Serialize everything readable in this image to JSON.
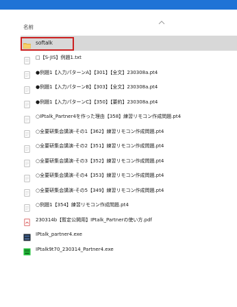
{
  "header": {
    "name_column": "名前"
  },
  "files": [
    {
      "label": "softalk",
      "icon": "folder-icon",
      "selected": true
    },
    {
      "label": "□【S-JIS】例題1.txt",
      "icon": "text-file-icon"
    },
    {
      "label": "●例題1【入力パターンA】【301】【全文】230308a.pt4",
      "icon": "document-icon"
    },
    {
      "label": "●例題1【入力パターンB】【303】【全文】230308a.pt4",
      "icon": "document-icon"
    },
    {
      "label": "●例題1【入力パターンC】【350】【要約】230308a.pt4",
      "icon": "document-icon"
    },
    {
      "label": "○IPtalk_Partner4を作った理由【358】練習リモコン作成問題.pt4",
      "icon": "document-icon"
    },
    {
      "label": "○全要研集会講演-その1【362】練習リモコン作成問題.pt4",
      "icon": "document-icon"
    },
    {
      "label": "○全要研集会講演-その2【351】練習リモコン作成問題.pt4",
      "icon": "document-icon"
    },
    {
      "label": "○全要研集会講演-その3【352】練習リモコン作成問題.pt4",
      "icon": "document-icon"
    },
    {
      "label": "○全要研集会講演-その4【353】練習リモコン作成問題.pt4",
      "icon": "document-icon"
    },
    {
      "label": "○全要研集会講演-その5【349】練習リモコン作成問題.pt4",
      "icon": "document-icon"
    },
    {
      "label": "○例題1【354】練習リモコン作成問題.pt4",
      "icon": "document-icon"
    },
    {
      "label": "230314b【暫定公開用】IPtalk_Partnerの使い方.pdf",
      "icon": "pdf-file-icon"
    },
    {
      "label": "IPtalk_partner4.exe",
      "icon": "app-exe-icon"
    },
    {
      "label": "IPtalk9t70_230314_Partner4.exe",
      "icon": "green-exe-icon"
    }
  ],
  "colors": {
    "accent_bar": "#1f73d6",
    "selection": "#d8d8d8",
    "highlight_border": "#cc1f1f",
    "folder": "#f3c44d"
  }
}
